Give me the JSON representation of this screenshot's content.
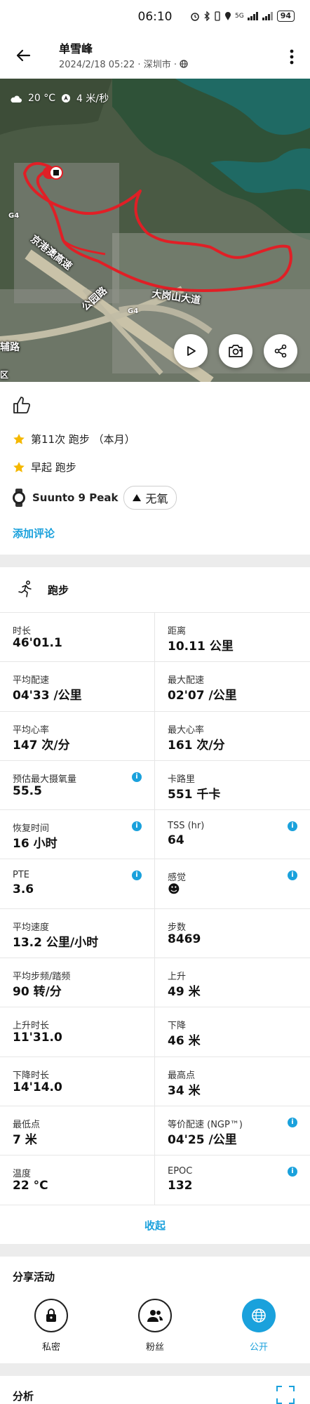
{
  "status_bar": {
    "time": "06:10",
    "signal_5g": "5G",
    "battery": "94"
  },
  "header": {
    "user_name": "单雪峰",
    "date_time": "2024/2/18 05:22",
    "location": "深圳市",
    "separator": "·"
  },
  "map": {
    "temperature": "20 °C",
    "wind": "4 米/秒",
    "road_labels": [
      "京港澳高速",
      "公园路",
      "大岗山大道",
      "辅路",
      "区"
    ],
    "highway_badge": "G4"
  },
  "achievements": [
    {
      "icon": "star-icon",
      "text": "第11次 跑步 （本月）"
    },
    {
      "icon": "star-icon",
      "text": "早起 跑步"
    }
  ],
  "device": {
    "name": "Suunto 9 Peak",
    "zone_label": "无氧"
  },
  "add_comment": "添加评论",
  "sport": {
    "name": "跑步"
  },
  "stats": [
    [
      {
        "label": "时长",
        "value": "46'01.1"
      },
      {
        "label": "距离",
        "value": "10.11 公里"
      }
    ],
    [
      {
        "label": "平均配速",
        "value": "04'33 /公里"
      },
      {
        "label": "最大配速",
        "value": "02'07 /公里"
      }
    ],
    [
      {
        "label": "平均心率",
        "value": "147 次/分"
      },
      {
        "label": "最大心率",
        "value": "161 次/分"
      }
    ],
    [
      {
        "label": "预估最大摄氧量",
        "value": "55.5",
        "info": true
      },
      {
        "label": "卡路里",
        "value": "551 千卡"
      }
    ],
    [
      {
        "label": "恢复时间",
        "value": "16 小时",
        "info": true
      },
      {
        "label": "TSS (hr)",
        "value": "64",
        "info": true
      }
    ],
    [
      {
        "label": "PTE",
        "value": "3.6",
        "info": true
      },
      {
        "label": "感觉",
        "value": "☻",
        "info": true
      }
    ],
    [
      {
        "label": "平均速度",
        "value": "13.2 公里/小时"
      },
      {
        "label": "步数",
        "value": "8469"
      }
    ],
    [
      {
        "label": "平均步频/踏频",
        "value": "90 转/分"
      },
      {
        "label": "上升",
        "value": "49 米"
      }
    ],
    [
      {
        "label": "上升时长",
        "value": "11'31.0"
      },
      {
        "label": "下降",
        "value": "46 米"
      }
    ],
    [
      {
        "label": "下降时长",
        "value": "14'14.0"
      },
      {
        "label": "最高点",
        "value": "34 米"
      }
    ],
    [
      {
        "label": "最低点",
        "value": "7 米"
      },
      {
        "label": "等价配速 (NGP™)",
        "value": "04'25 /公里",
        "info": true
      }
    ],
    [
      {
        "label": "温度",
        "value": "22 °C"
      },
      {
        "label": "EPOC",
        "value": "132",
        "info": true
      }
    ]
  ],
  "info_glyph": "i",
  "collapse_label": "收起",
  "share": {
    "title": "分享活动",
    "options": [
      {
        "label": "私密",
        "icon": "lock-icon",
        "selected": false
      },
      {
        "label": "粉丝",
        "icon": "followers-icon",
        "selected": false
      },
      {
        "label": "公开",
        "icon": "globe-icon",
        "selected": true
      }
    ]
  },
  "analysis": {
    "title": "分析"
  },
  "colors": {
    "accent": "#1aa1dc",
    "route": "#e01f26",
    "star": "#f5b800"
  }
}
